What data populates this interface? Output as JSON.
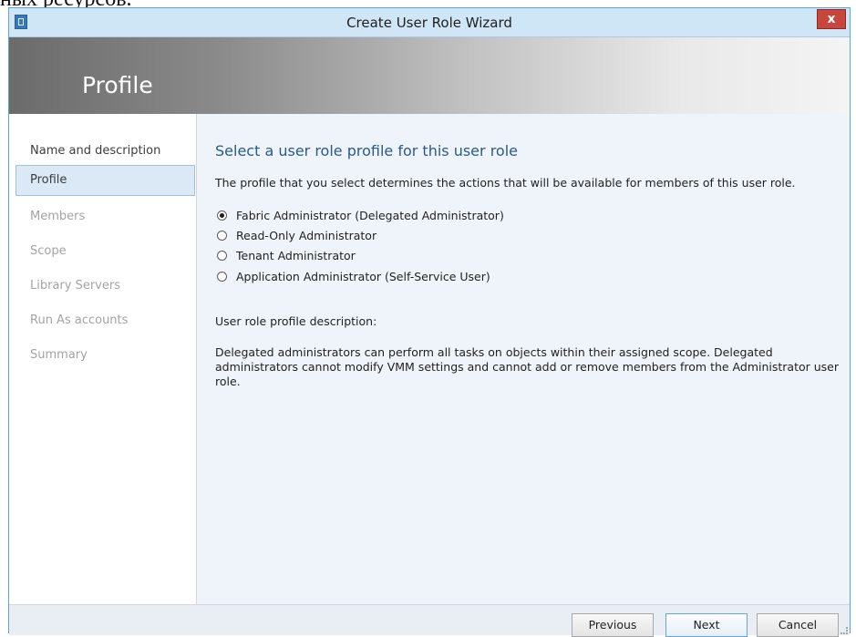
{
  "document_fragment": "ных ресурсов.",
  "window": {
    "title": "Create User Role Wizard",
    "close_label": "x"
  },
  "banner": {
    "title": "Profile"
  },
  "nav": {
    "items": [
      {
        "label": "Name and description"
      },
      {
        "label": "Profile"
      },
      {
        "label": "Members"
      },
      {
        "label": "Scope"
      },
      {
        "label": "Library Servers"
      },
      {
        "label": "Run As accounts"
      },
      {
        "label": "Summary"
      }
    ],
    "selected": "Profile"
  },
  "content": {
    "heading": "Select a user role profile for this user role",
    "lead": "The profile that you select determines the actions that will be available for members of this user role.",
    "profiles": [
      {
        "label": "Fabric Administrator (Delegated Administrator)",
        "checked": true
      },
      {
        "label": "Read-Only Administrator",
        "checked": false
      },
      {
        "label": "Tenant Administrator",
        "checked": false
      },
      {
        "label": "Application Administrator (Self-Service User)",
        "checked": false
      }
    ],
    "description_label": "User role profile description:",
    "description_text": "Delegated administrators can perform all tasks on objects within their assigned scope. Delegated administrators cannot modify VMM settings and cannot add or remove members from the Administrator user role."
  },
  "footer": {
    "previous_label": "Previous",
    "next_label": "Next",
    "cancel_label": "Cancel"
  },
  "colors": {
    "title_bar": "#cfe6f7",
    "window_border": "#5aa4d8",
    "close_button": "#c9463d",
    "heading_text": "#2a5a8a",
    "nav_selected_bg": "#dbe9f7"
  },
  "icons": {
    "app": "window-app-icon",
    "close": "close-icon"
  }
}
